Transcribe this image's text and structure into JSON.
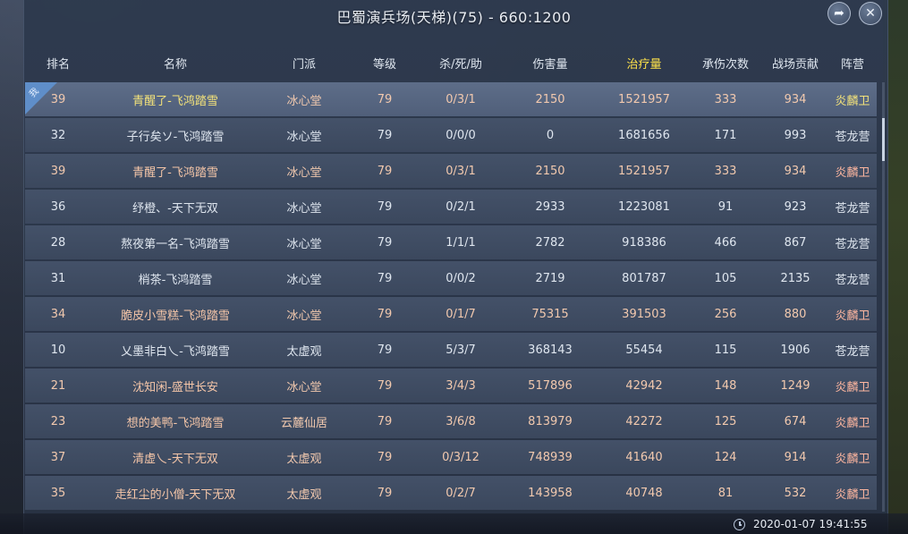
{
  "title": "巴蜀演兵场(天梯)(75) - 660:1200",
  "icons": {
    "share": "share-arrow-icon",
    "close": "close-icon",
    "clock": "clock-icon"
  },
  "columns": {
    "rank": "排名",
    "name": "名称",
    "school": "门派",
    "level": "等级",
    "kda": "杀/死/助",
    "damage": "伤害量",
    "heal": "治疗量",
    "hits_taken": "承伤次数",
    "contribution": "战场贡献",
    "camp": "阵营"
  },
  "self_tag": "我",
  "rows": [
    {
      "rank": "39",
      "name": "青醒了-飞鸿踏雪",
      "school": "冰心堂",
      "level": "79",
      "kda": "0/3/1",
      "damage": "2150",
      "heal": "1521957",
      "hits_taken": "333",
      "contribution": "934",
      "camp": "炎麟卫"
    },
    {
      "rank": "32",
      "name": "子行矣ソ-飞鸿踏雪",
      "school": "冰心堂",
      "level": "79",
      "kda": "0/0/0",
      "damage": "0",
      "heal": "1681656",
      "hits_taken": "171",
      "contribution": "993",
      "camp": "苍龙营"
    },
    {
      "rank": "39",
      "name": "青醒了-飞鸿踏雪",
      "school": "冰心堂",
      "level": "79",
      "kda": "0/3/1",
      "damage": "2150",
      "heal": "1521957",
      "hits_taken": "333",
      "contribution": "934",
      "camp": "炎麟卫"
    },
    {
      "rank": "36",
      "name": "纾橙、-天下无双",
      "school": "冰心堂",
      "level": "79",
      "kda": "0/2/1",
      "damage": "2933",
      "heal": "1223081",
      "hits_taken": "91",
      "contribution": "923",
      "camp": "苍龙营"
    },
    {
      "rank": "28",
      "name": "熬夜第一名-飞鸿踏雪",
      "school": "冰心堂",
      "level": "79",
      "kda": "1/1/1",
      "damage": "2782",
      "heal": "918386",
      "hits_taken": "466",
      "contribution": "867",
      "camp": "苍龙营"
    },
    {
      "rank": "31",
      "name": "梢茶-飞鸿踏雪",
      "school": "冰心堂",
      "level": "79",
      "kda": "0/0/2",
      "damage": "2719",
      "heal": "801787",
      "hits_taken": "105",
      "contribution": "2135",
      "camp": "苍龙营"
    },
    {
      "rank": "34",
      "name": "脆皮小雪糕-飞鸿踏雪",
      "school": "冰心堂",
      "level": "79",
      "kda": "0/1/7",
      "damage": "75315",
      "heal": "391503",
      "hits_taken": "256",
      "contribution": "880",
      "camp": "炎麟卫"
    },
    {
      "rank": "10",
      "name": "乂墨非白乀-飞鸿踏雪",
      "school": "太虚观",
      "level": "79",
      "kda": "5/3/7",
      "damage": "368143",
      "heal": "55454",
      "hits_taken": "115",
      "contribution": "1906",
      "camp": "苍龙营"
    },
    {
      "rank": "21",
      "name": "沈知闲-盛世长安",
      "school": "冰心堂",
      "level": "79",
      "kda": "3/4/3",
      "damage": "517896",
      "heal": "42942",
      "hits_taken": "148",
      "contribution": "1249",
      "camp": "炎麟卫"
    },
    {
      "rank": "23",
      "name": "想的美鸭-飞鸿踏雪",
      "school": "云麓仙居",
      "level": "79",
      "kda": "3/6/8",
      "damage": "813979",
      "heal": "42272",
      "hits_taken": "125",
      "contribution": "674",
      "camp": "炎麟卫"
    },
    {
      "rank": "37",
      "name": "清虚乀-天下无双",
      "school": "太虚观",
      "level": "79",
      "kda": "0/3/12",
      "damage": "748939",
      "heal": "41640",
      "hits_taken": "124",
      "contribution": "914",
      "camp": "炎麟卫"
    },
    {
      "rank": "35",
      "name": "走红尘的小僧-天下无双",
      "school": "太虚观",
      "level": "79",
      "kda": "0/2/7",
      "damage": "143958",
      "heal": "40748",
      "hits_taken": "81",
      "contribution": "532",
      "camp": "炎麟卫"
    }
  ],
  "footer": {
    "timestamp": "2020-01-07  19:41:55"
  },
  "colors": {
    "highlight_header": "#ffe34a",
    "self_row": "#f3e27a",
    "faction_yan": "#f5c6a8",
    "faction_cang": "#dfe6ef",
    "self_tag": "#5f8ec9"
  }
}
